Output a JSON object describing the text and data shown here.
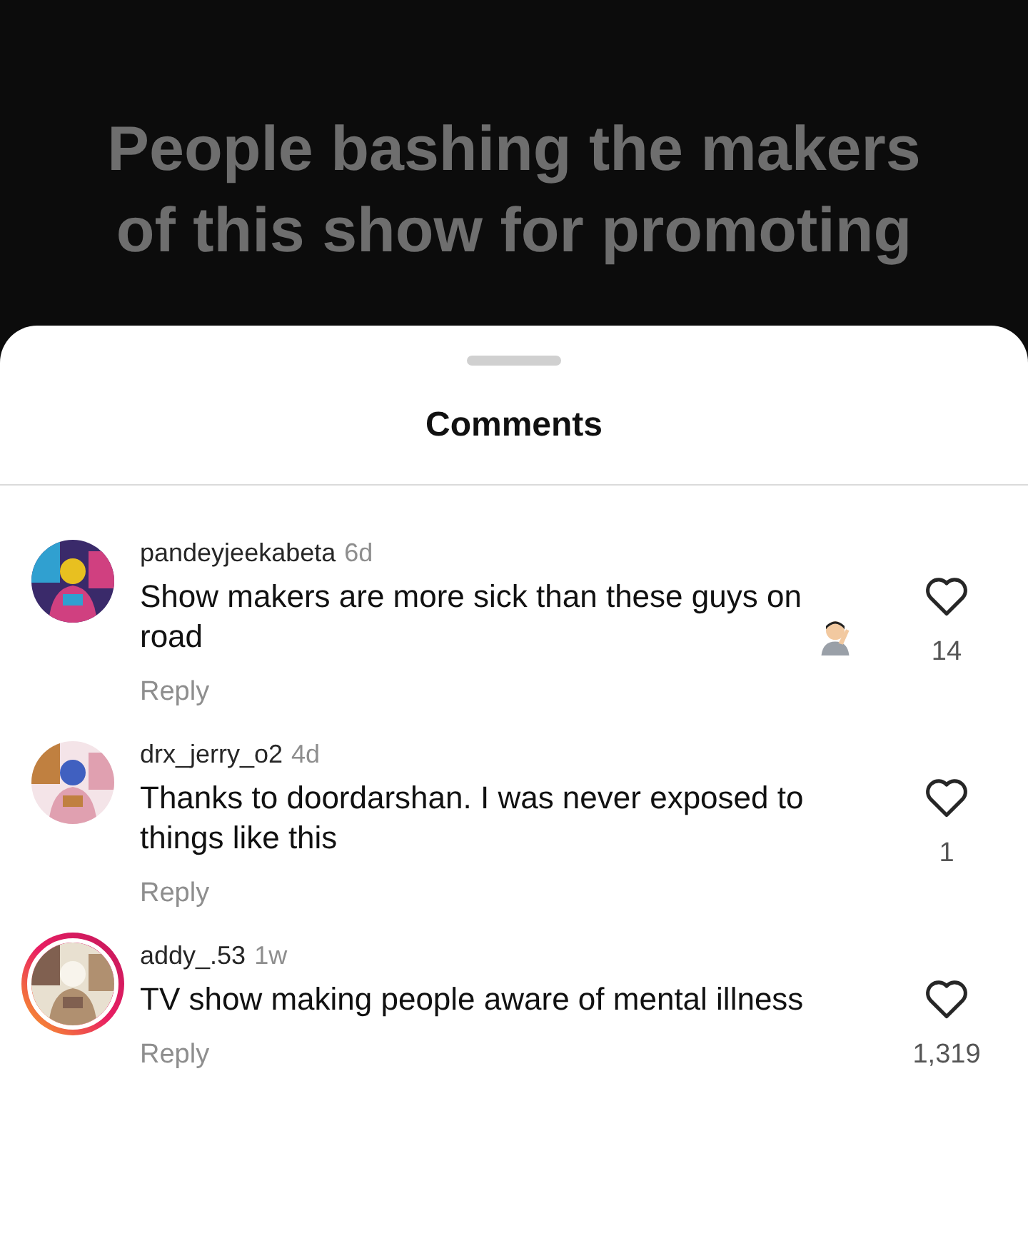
{
  "background_post": {
    "lines": [
      "People bashing the makers",
      "of this show for promoting"
    ]
  },
  "sheet": {
    "title": "Comments"
  },
  "comments": [
    {
      "avatar": {
        "kind": "picture",
        "story_ring": false
      },
      "username": "pandeyjeekabeta",
      "time": "6d",
      "text": "Show makers are more sick than these guys on road",
      "emoji": true,
      "liked": false,
      "likes": "14",
      "reply": "Reply"
    },
    {
      "avatar": {
        "kind": "picture",
        "story_ring": false
      },
      "username": "drx_jerry_o2",
      "time": "4d",
      "text": "Thanks to doordarshan.  I was never exposed to things like this",
      "emoji": false,
      "liked": false,
      "likes": "1",
      "reply": "Reply"
    },
    {
      "avatar": {
        "kind": "picture",
        "story_ring": true
      },
      "username": "addy_.53",
      "time": "1w",
      "text": "TV show making people aware of mental illness",
      "emoji": false,
      "liked": false,
      "likes": "1,319",
      "reply": "Reply"
    }
  ]
}
